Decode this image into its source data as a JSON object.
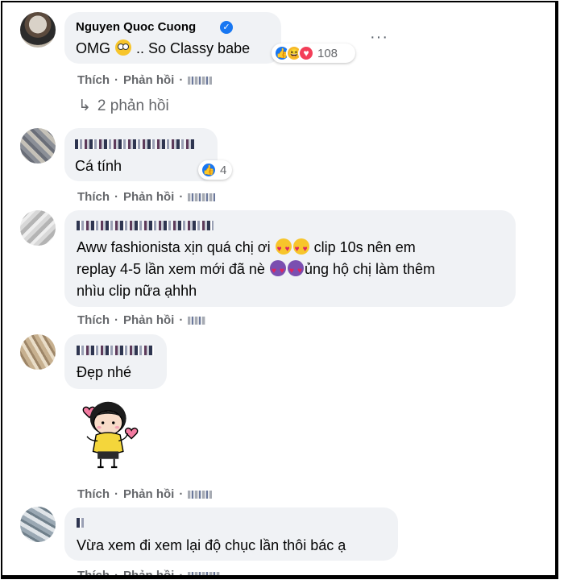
{
  "comments": [
    {
      "author": "Nguyen Quoc Cuong",
      "verified": true,
      "text_before": "OMG",
      "text_after": ".. So Classy babe",
      "emoji": "flushed-face",
      "reaction_count": "108",
      "reactions": [
        "like",
        "haha",
        "love"
      ],
      "like_label": "Thích",
      "reply_label": "Phản hồi",
      "replies_label": "2 phản hồi"
    },
    {
      "author_hidden": true,
      "text": "Cá tính",
      "reaction_count": "4",
      "reactions": [
        "like"
      ],
      "like_label": "Thích",
      "reply_label": "Phản hồi"
    },
    {
      "author_hidden": true,
      "line1_a": "Aww fashionista xịn quá chị ơi",
      "line1_b": "clip 10s nên em",
      "line2_a": "replay 4-5 lần xem mới đã nè",
      "line2_b": "ủng hộ chị làm thêm",
      "line3": "nhìu clip nữa ạhhh",
      "emoji": [
        "heart-eyes",
        "smiling-purple-face"
      ],
      "like_label": "Thích",
      "reply_label": "Phản hồi"
    },
    {
      "author_hidden": true,
      "text": "Đẹp nhé",
      "sticker": "girl-heart-sticker",
      "like_label": "Thích",
      "reply_label": "Phản hồi"
    },
    {
      "author_hidden": true,
      "text": "Vừa xem đi xem lại độ chục lần thôi bác ạ",
      "like_label": "Thích",
      "reply_label": "Phản hồi"
    }
  ],
  "colors": {
    "bubble": "#f0f2f5",
    "action_text": "#65676b",
    "like_blue": "#1877f2",
    "love_red": "#f33e58",
    "haha_yellow": "#f7b928"
  }
}
